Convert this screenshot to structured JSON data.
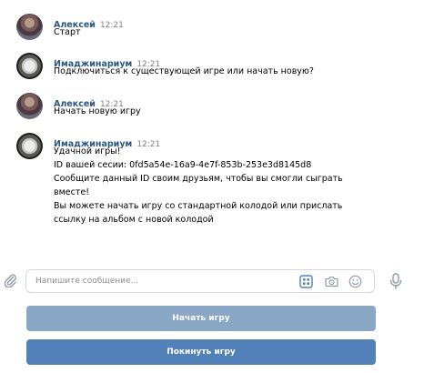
{
  "messages": [
    {
      "author": "Алексей",
      "time": "12:21",
      "lines": [
        "Старт"
      ]
    },
    {
      "author": "Имаджинариум",
      "time": "12:21",
      "lines": [
        "Подключиться к существующей игре или начать новую?"
      ]
    },
    {
      "author": "Алексей",
      "time": "12:21",
      "lines": [
        "Начать новую игру"
      ]
    },
    {
      "author": "Имаджинариум",
      "time": "12:21",
      "lines": [
        "Удачной игры!",
        "ID вашей сесии: 0fd5a54e-16a9-4e7f-853b-253e3d8145d8",
        "Сообщите данный ID своим друзьям, чтобы вы смогли сыграть",
        "вместе!",
        "Вы можете начать игру со стандартной колодой или прислать",
        "ссылку на альбом с новой колодой"
      ]
    }
  ],
  "composer": {
    "placeholder": "Напишите сообщение..."
  },
  "buttons": {
    "start": "Начать игру",
    "leave": "Покинуть игру"
  },
  "colors": {
    "author": "#2a5885",
    "button_start": "#8aa7c6",
    "button_leave": "#5181b8"
  },
  "icons": [
    "paperclip-icon",
    "keyboard-icon",
    "camera-icon",
    "emoji-icon",
    "microphone-icon"
  ]
}
